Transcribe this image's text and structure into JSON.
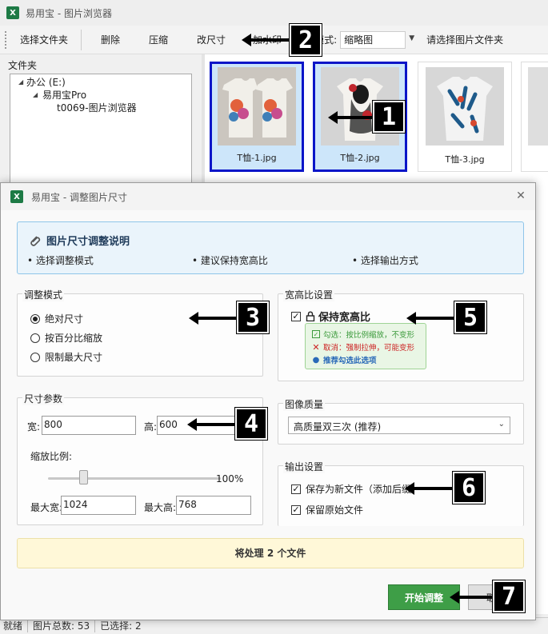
{
  "main_window": {
    "app_icon": "X",
    "title": "易用宝 - 图片浏览器",
    "toolbar": {
      "select_folder": "选择文件夹",
      "delete": "删除",
      "compress": "压缩",
      "resize": "改尺寸",
      "watermark_partial": "加水印",
      "view_mode_label": "视图模式:",
      "view_mode_value": "缩略图",
      "folder_hint": "请选择图片文件夹"
    },
    "folder_label": "文件夹",
    "tree": [
      {
        "label": "办公 (E:)"
      },
      {
        "label": "易用宝Pro"
      },
      {
        "label": "t0069-图片浏览器"
      }
    ],
    "thumbnails": [
      {
        "caption": "T恤-1.jpg",
        "selected": true
      },
      {
        "caption": "T恤-2.jpg",
        "selected": true
      },
      {
        "caption": "T恤-3.jpg",
        "selected": false
      }
    ],
    "status": {
      "ready": "就绪",
      "total": "图片总数: 53",
      "selected": "已选择: 2"
    }
  },
  "dialog": {
    "app_icon": "X",
    "title": "易用宝 - 调整图片尺寸",
    "info": {
      "title": "图片尺寸调整说明",
      "points": [
        "• 选择调整模式",
        "• 建议保持宽高比",
        "• 选择输出方式"
      ]
    },
    "mode": {
      "label": "调整模式",
      "options": [
        "绝对尺寸",
        "按百分比缩放",
        "限制最大尺寸"
      ],
      "selected_index": 0
    },
    "size": {
      "label": "尺寸参数",
      "width_label": "宽:",
      "width_value": "800",
      "height_label": "高:",
      "height_value": "600",
      "scale_label": "缩放比例:",
      "scale_value": "100%",
      "scale_level": 100,
      "max_width_label": "最大宽:",
      "max_width_value": "1024",
      "max_height_label": "最大高:",
      "max_height_value": "768"
    },
    "aspect": {
      "label": "宽高比设置",
      "keep_label": "保持宽高比",
      "keep_checked": true,
      "tip_checked": "勾选：按比例缩放，不变形",
      "tip_unchecked": "取消：强制拉伸，可能变形",
      "tip_recommend": "推荐勾选此选项"
    },
    "quality": {
      "label": "图像质量",
      "value": "高质量双三次 (推荐)"
    },
    "output": {
      "label": "输出设置",
      "save_new_label": "保存为新文件（添加后缀",
      "save_new_checked": true,
      "keep_original_label": "保留原始文件",
      "keep_original_checked": true
    },
    "summary": "将处理 2 个文件",
    "start_button": "开始调整",
    "cancel_button": "取消"
  },
  "annotations": [
    "1",
    "2",
    "3",
    "4",
    "5",
    "6",
    "7"
  ],
  "colors": {
    "selection_border": "#0a15c8",
    "start_button": "#3e9e47",
    "info_bg": "#eaf4fb",
    "summary_bg": "#fff8d8",
    "excel_green": "#1d7a45"
  }
}
